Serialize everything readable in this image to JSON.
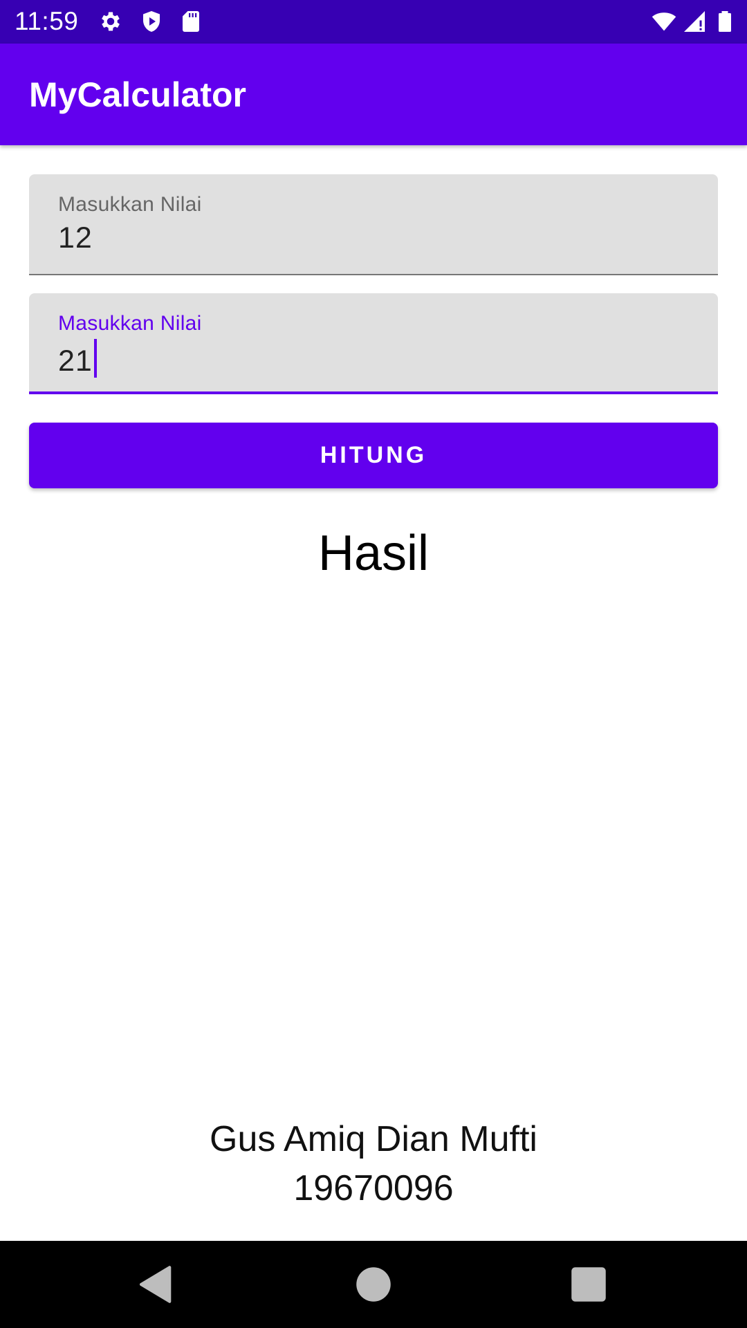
{
  "status_bar": {
    "time": "11:59",
    "left_icons": [
      "gear-icon",
      "shield-icon",
      "sd-card-icon"
    ],
    "right_icons": [
      "wifi-icon",
      "signal-icon",
      "battery-icon"
    ]
  },
  "app_bar": {
    "title": "MyCalculator",
    "color": "#6200ee"
  },
  "form": {
    "field_1": {
      "label": "Masukkan Nilai",
      "value": "12"
    },
    "field_2": {
      "label": "Masukkan Nilai",
      "value": "21",
      "focused": true
    },
    "button_label": "HITUNG"
  },
  "result": {
    "text": "Hasil"
  },
  "author": {
    "name": "Gus Amiq Dian Mufti",
    "id": "19670096"
  },
  "nav_bar": {
    "buttons": [
      "back-icon",
      "home-icon",
      "recents-icon"
    ]
  },
  "colors": {
    "primary": "#6200ee",
    "primary_dark": "#3700b3",
    "field_bg": "#e0e0e0"
  }
}
